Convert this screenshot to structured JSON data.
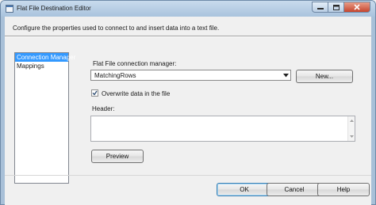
{
  "window": {
    "title": "Flat File Destination Editor",
    "description": "Configure the properties used to connect to and insert data into a text file."
  },
  "nav": {
    "items": [
      {
        "label": "Connection Manager",
        "selected": true
      },
      {
        "label": "Mappings",
        "selected": false
      }
    ]
  },
  "connection": {
    "label": "Flat File connection manager:",
    "value": "MatchingRows",
    "new_button": "New..."
  },
  "overwrite": {
    "label": "Overwrite data in the file",
    "checked": true
  },
  "header": {
    "label": "Header:",
    "value": ""
  },
  "buttons": {
    "preview": "Preview",
    "ok": "OK",
    "cancel": "Cancel",
    "help": "Help"
  },
  "colors": {
    "selection": "#3399ff",
    "close_button": "#c6452e"
  },
  "icons": {
    "window": "window-app-icon",
    "minimize": "minimize-icon",
    "maximize": "maximize-icon",
    "close": "close-icon",
    "dropdown": "chevron-down-icon",
    "check": "checkmark-icon"
  }
}
